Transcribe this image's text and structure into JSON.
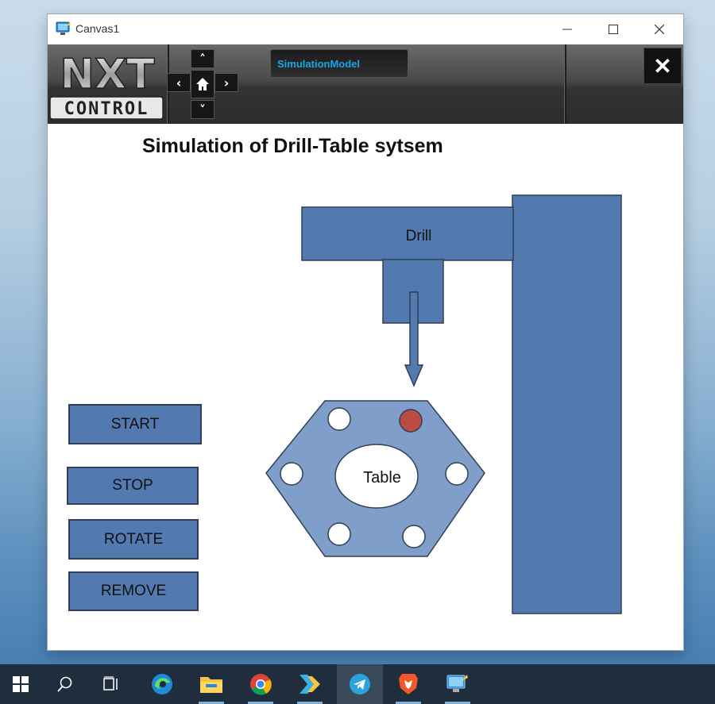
{
  "window": {
    "title": "Canvas1"
  },
  "toolbar": {
    "logo_text_top": "NXT",
    "logo_text_bottom": "CONTROL",
    "tab_label": "SimulationModel"
  },
  "page": {
    "title": "Simulation of Drill-Table sytsem",
    "drill_label": "Drill",
    "table_label": "Table"
  },
  "controls": {
    "start": "START",
    "stop": "STOP",
    "rotate": "ROTATE",
    "remove": "REMOVE"
  },
  "table_holes": [
    {
      "state": "empty"
    },
    {
      "state": "marked"
    },
    {
      "state": "empty"
    },
    {
      "state": "empty"
    },
    {
      "state": "empty"
    },
    {
      "state": "empty"
    }
  ],
  "colors": {
    "machine_blue": "#5279b0",
    "table_blue": "#7f9ec9",
    "marked_hole": "#bd4a43",
    "tab_text": "#19a6e6"
  },
  "taskbar": {
    "items": [
      "windows-start",
      "search",
      "task-view",
      "edge",
      "file-explorer",
      "chrome",
      "app-arrow",
      "telegram",
      "brave",
      "canvas-app"
    ]
  }
}
